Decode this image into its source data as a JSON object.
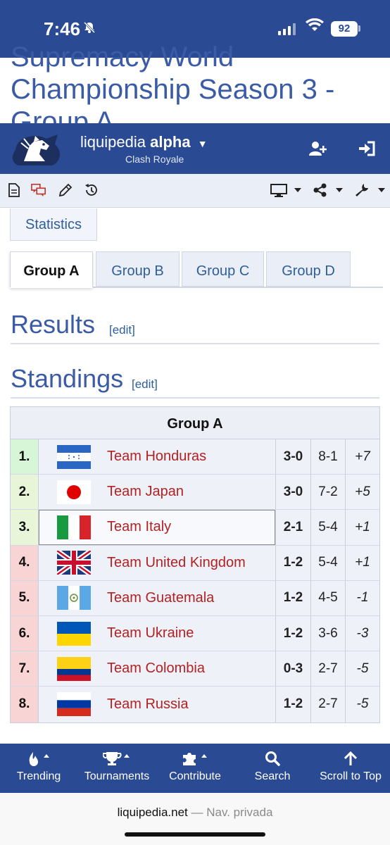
{
  "status_bar": {
    "time": "7:46",
    "battery": "92"
  },
  "page": {
    "title": "Supremacy World Championship Season 3 - Group A"
  },
  "header": {
    "brand": "liquipedia",
    "brand_bold": "alpha",
    "subtitle": "Clash Royale"
  },
  "tabs": {
    "statistics": "Statistics",
    "groups": [
      "Group A",
      "Group B",
      "Group C",
      "Group D"
    ],
    "active": "Group A"
  },
  "sections": {
    "results": {
      "title": "Results",
      "edit": "[edit]"
    },
    "standings": {
      "title": "Standings",
      "edit": "[edit]"
    }
  },
  "standings": {
    "header": "Group A",
    "rows": [
      {
        "pos": "1.",
        "team": "Team Honduras",
        "score": "3-0",
        "games": "8-1",
        "diff": "+7",
        "status": "advance"
      },
      {
        "pos": "2.",
        "team": "Team Japan",
        "score": "3-0",
        "games": "7-2",
        "diff": "+5",
        "status": "advance2"
      },
      {
        "pos": "3.",
        "team": "Team Italy",
        "score": "2-1",
        "games": "5-4",
        "diff": "+1",
        "status": "advance2"
      },
      {
        "pos": "4.",
        "team": "Team United Kingdom",
        "score": "1-2",
        "games": "5-4",
        "diff": "+1",
        "status": "eliminated"
      },
      {
        "pos": "5.",
        "team": "Team Guatemala",
        "score": "1-2",
        "games": "4-5",
        "diff": "-1",
        "status": "eliminated"
      },
      {
        "pos": "6.",
        "team": "Team Ukraine",
        "score": "1-2",
        "games": "3-6",
        "diff": "-3",
        "status": "eliminated"
      },
      {
        "pos": "7.",
        "team": "Team Colombia",
        "score": "0-3",
        "games": "2-7",
        "diff": "-5",
        "status": "eliminated"
      },
      {
        "pos": "8.",
        "team": "Team Russia",
        "score": "1-2",
        "games": "2-7",
        "diff": "-5",
        "status": "eliminated"
      }
    ]
  },
  "bottom_nav": {
    "items": [
      {
        "label": "Trending",
        "icon": "fire-icon"
      },
      {
        "label": "Tournaments",
        "icon": "trophy-icon"
      },
      {
        "label": "Contribute",
        "icon": "puzzle-icon"
      },
      {
        "label": "Search",
        "icon": "search-icon"
      },
      {
        "label": "Scroll to Top",
        "icon": "arrow-up-icon"
      }
    ]
  },
  "browser": {
    "domain": "liquipedia.net",
    "mode": "— Nav. privada"
  },
  "colors": {
    "brand_blue": "#2a4a94",
    "link_red": "#b22222",
    "advance_green": "#d7f5d7",
    "advance2_green": "#e8f5d8",
    "eliminated_red": "#f9d4d4"
  }
}
